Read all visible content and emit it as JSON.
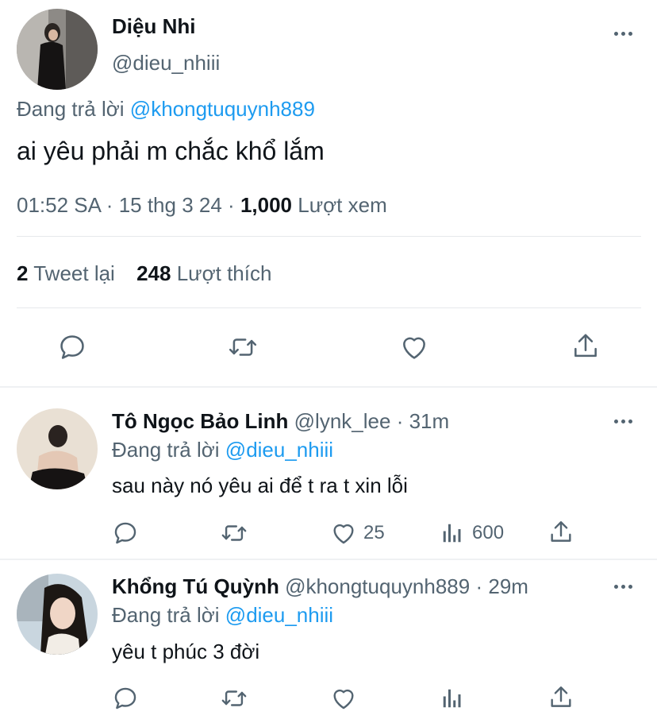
{
  "main_tweet": {
    "author_name": "Diệu Nhi",
    "author_handle": "@dieu_nhiii",
    "reply_prefix": "Đang trả lời",
    "reply_to": "@khongtuquynh889",
    "text": "ai yêu phải m chắc khổ lắm",
    "time": "01:52 SA",
    "date": "15 thg 3 24",
    "sep": "·",
    "views_count": "1,000",
    "views_label": "Lượt xem",
    "retweets_count": "2",
    "retweets_label": "Tweet lại",
    "likes_count": "248",
    "likes_label": "Lượt thích"
  },
  "replies": [
    {
      "author_name": "Tô Ngọc Bảo Linh",
      "author_handle": "@lynk_lee",
      "sep": "·",
      "time_ago": "31m",
      "reply_prefix": "Đang trả lời",
      "reply_to": "@dieu_nhiii",
      "text": "sau này nó yêu ai để t ra t xin lỗi",
      "likes": "25",
      "views": "600"
    },
    {
      "author_name": "Khổng Tú Quỳnh",
      "author_handle": "@khongtuquynh889",
      "sep": "·",
      "time_ago": "29m",
      "reply_prefix": "Đang trả lời",
      "reply_to": "@dieu_nhiii",
      "text": "yêu t phúc 3 đời",
      "likes": "",
      "views": ""
    }
  ],
  "colors": {
    "link": "#1d9bf0",
    "secondary_text": "#536471",
    "primary_text": "#0f1419"
  }
}
